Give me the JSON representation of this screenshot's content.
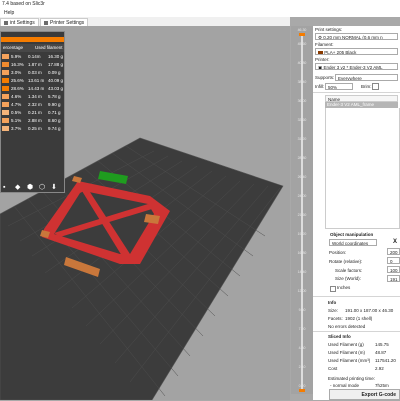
{
  "window": {
    "title": "7.4 based on Slic3r"
  },
  "menu": {
    "help": "Help"
  },
  "tabs": [
    {
      "label": "int Settings"
    },
    {
      "label": "Printer Settings"
    }
  ],
  "legend": {
    "col_percentage": "ercentage",
    "col_used_filament": "Used filament",
    "rows": [
      {
        "pct": "5.9%",
        "len": "0.14m",
        "g": "16.30 g",
        "color": "#f5a25b"
      },
      {
        "pct": "16.3%",
        "len": "1.87 m",
        "g": "17.88 g",
        "color": "#f08b2f"
      },
      {
        "pct": "3.0%",
        "len": "0.03 m",
        "g": "0.09 g",
        "color": "#f5a25b"
      },
      {
        "pct": "25.6%",
        "len": "13.61 m",
        "g": "40.09 g",
        "color": "#f57c00"
      },
      {
        "pct": "28.6%",
        "len": "14.43 m",
        "g": "43.03 g",
        "color": "#f57c00"
      },
      {
        "pct": "4.6%",
        "len": "1.34 m",
        "g": "5.78 g",
        "color": "#f5a25b"
      },
      {
        "pct": "4.7%",
        "len": "2.32 m",
        "g": "9.90 g",
        "color": "#f5a25b"
      },
      {
        "pct": "0.5%",
        "len": "0.21 m",
        "g": "0.71 g",
        "color": "#f5b47a"
      },
      {
        "pct": "5.1%",
        "len": "2.88 m",
        "g": "8.60 g",
        "color": "#f5a25b"
      },
      {
        "pct": "3.7%",
        "len": "0.25 m",
        "g": "9.74 g",
        "color": "#f5b47a"
      }
    ]
  },
  "scroll": {
    "left": "0",
    "right": "13827"
  },
  "slider": {
    "top_label": "46.30",
    "bottom_label": "0.20",
    "ticks": [
      "45.60",
      "40.80",
      "38.40",
      "36.00",
      "33.60",
      "31.20",
      "28.80",
      "26.40",
      "24.00",
      "21.60",
      "19.20",
      "16.80",
      "14.40",
      "12.00",
      "9.60",
      "7.20",
      "4.80",
      "2.40",
      "0.20"
    ]
  },
  "right_panel": {
    "print_settings_label": "Print settings:",
    "print_profile": "0.20 mm NORMAL (0.6 mm n",
    "filament_label": "Filament:",
    "filament_profile": "PLA+ 205 Black",
    "printer_label": "Printer:",
    "printer_profile": "Ender 3 v2 * Ender-3 V2 AML",
    "supports_label": "Supports:",
    "supports_value": "Everywhere",
    "infill_label": "Infill:",
    "infill_value": "50%",
    "brim_label": "Brim:",
    "name_header": "Name",
    "object_name": "Ender-3 V2 AML_frame",
    "object_manipulation": "Object manipulation",
    "coord_system": "World coordinates",
    "x_label": "X",
    "position_label": "Position:",
    "position_value": "200",
    "rotate_label": "Rotate (relative):",
    "rotate_value": "0",
    "scale_label": "Scale factors:",
    "scale_value": "100",
    "size_label": "Size (World):",
    "size_value": "191",
    "inches_label": "Inches",
    "info_label": "Info",
    "size_info_label": "Size:",
    "size_info_value": "191.00 x 187.00 x 46.30",
    "facets_label": "Facets:",
    "facets_value": "1902 (1 shell)",
    "errors": "No errors detected",
    "sliced_info": "Sliced Info",
    "used_g_label": "Used Filament (g)",
    "used_g_value": "145.75",
    "used_m_label": "Used Filament (m)",
    "used_m_value": "48.87",
    "used_mm3_label": "Used Filament (mm³)",
    "used_mm3_value": "117541.20",
    "cost_label": "Cost",
    "cost_value": "2.92",
    "est_time_label": "Estimated printing time:",
    "normal_mode_label": "- normal mode",
    "normal_mode_value": "7h25m",
    "export_label": "Export G-code"
  },
  "colors": {
    "accent": "#f57c00",
    "bed": "#3e3e3e",
    "part": "#cf3232",
    "brim_green": "#1f9c1f"
  }
}
